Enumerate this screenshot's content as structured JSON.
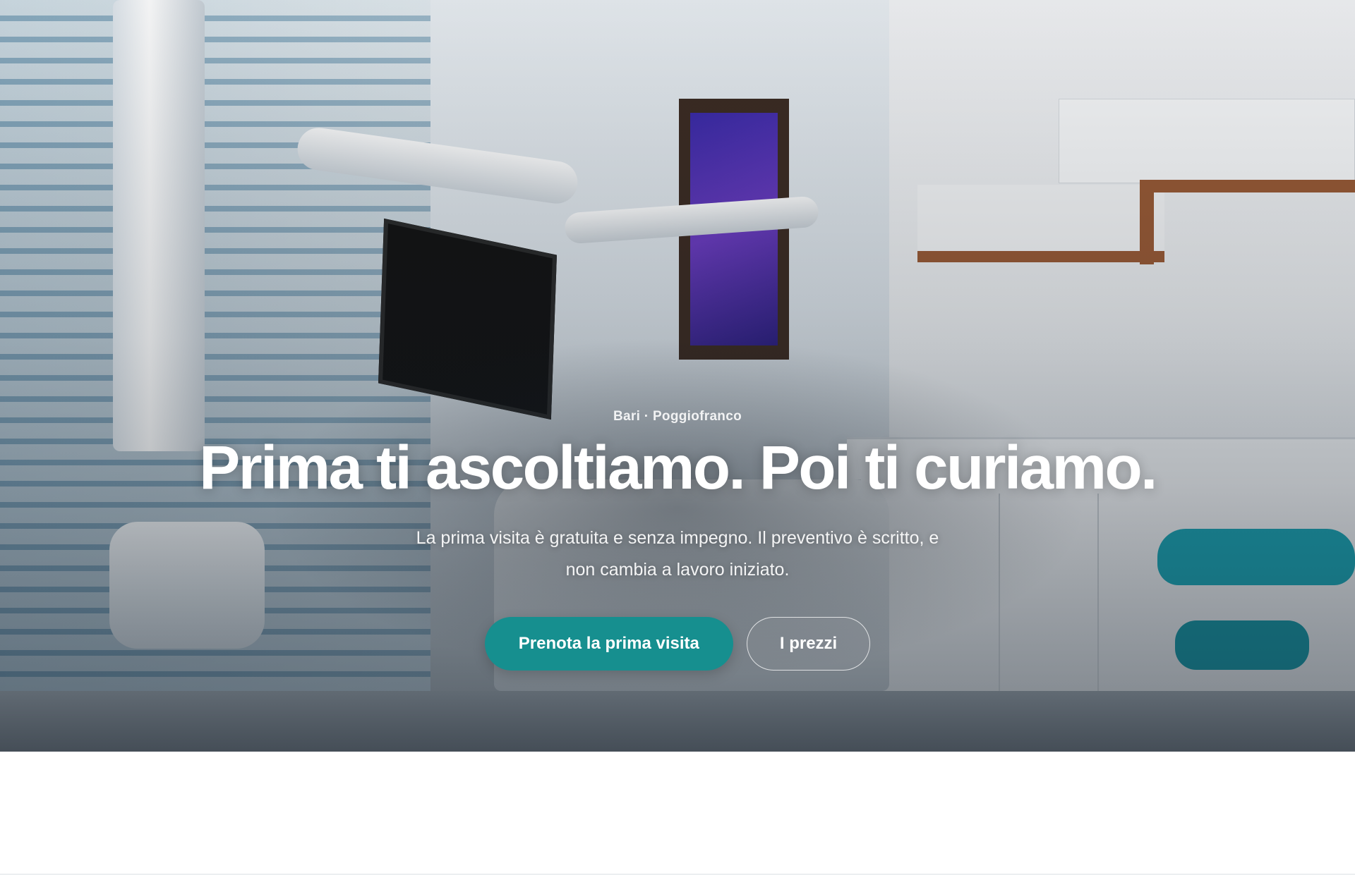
{
  "hero": {
    "eyebrow": "Bari · Poggiofranco",
    "headline": "Prima ti ascoltiamo. Poi ti curiamo.",
    "subtitle": "La prima visita è gratuita e senza impegno. Il preventivo è scritto, e non cambia a lavoro iniziato.",
    "primary_cta": "Prenota la prima visita",
    "secondary_cta": "I prezzi",
    "accent_color": "#168f8f"
  }
}
